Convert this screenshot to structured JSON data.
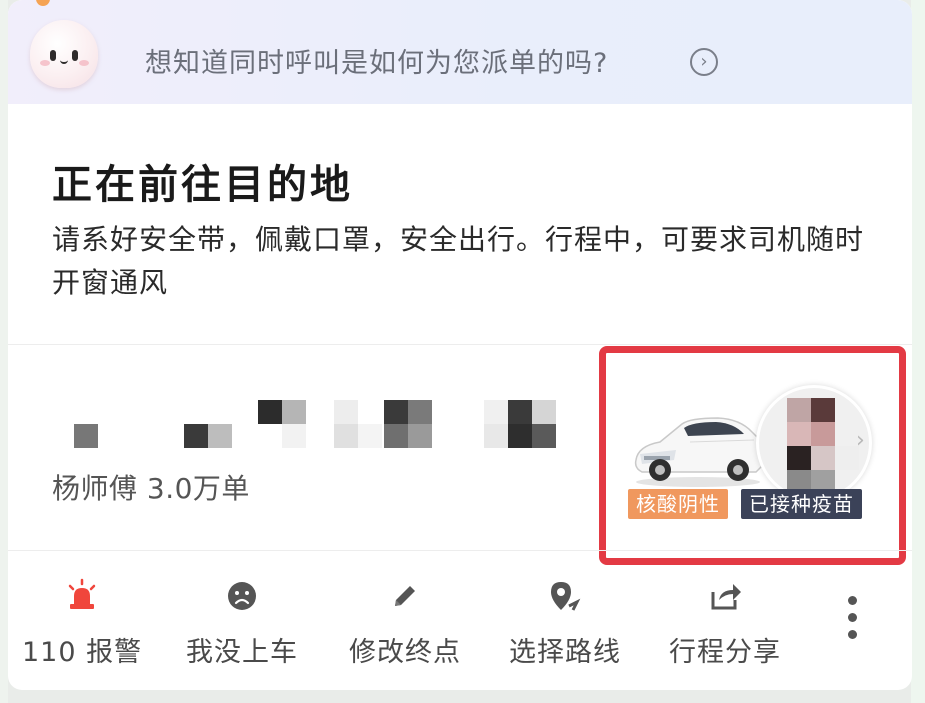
{
  "notice": {
    "text": "想知道同时呼叫是如何为您派单的吗?",
    "arrow_icon": "arrow-right-circle-icon"
  },
  "status": {
    "title": "正在前往目的地",
    "description": "请系好安全带，佩戴口罩，安全出行。行程中，可要求司机随时开窗通风"
  },
  "driver": {
    "info": "杨师傅  3.0万单",
    "plate_redacted": true
  },
  "badges": {
    "nucleic": "核酸阴性",
    "vaccine": "已接种疫苗"
  },
  "actions": [
    {
      "label": "110 报警",
      "icon": "alarm-siren-icon"
    },
    {
      "label": "我没上车",
      "icon": "sad-face-icon"
    },
    {
      "label": "修改终点",
      "icon": "pencil-icon"
    },
    {
      "label": "选择路线",
      "icon": "route-pin-icon"
    },
    {
      "label": "行程分享",
      "icon": "share-icon"
    }
  ],
  "colors": {
    "alarm": "#f0463c",
    "highlight_border": "#e33a44",
    "badge_orange": "#f0985e",
    "badge_dark": "#3b4258"
  }
}
